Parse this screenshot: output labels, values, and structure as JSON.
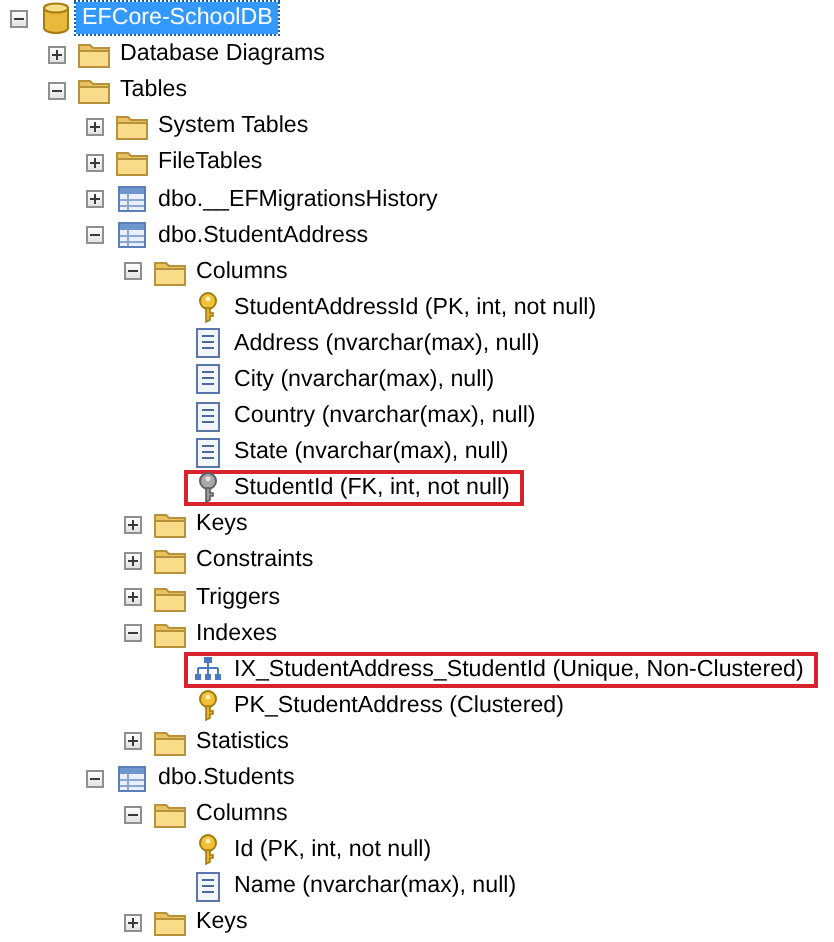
{
  "tree": [
    {
      "label": "EFCore-SchoolDB",
      "kind": "database",
      "expanded": true,
      "selected": true,
      "callout": false,
      "children": [
        {
          "label": "Database Diagrams",
          "kind": "folder",
          "expanded": false,
          "selected": false,
          "callout": false
        },
        {
          "label": "Tables",
          "kind": "folder",
          "expanded": true,
          "selected": false,
          "callout": false,
          "children": [
            {
              "label": "System Tables",
              "kind": "folder",
              "expanded": false,
              "selected": false,
              "callout": false
            },
            {
              "label": "FileTables",
              "kind": "folder",
              "expanded": false,
              "selected": false,
              "callout": false
            },
            {
              "label": "dbo.__EFMigrationsHistory",
              "kind": "table",
              "expanded": false,
              "selected": false,
              "callout": false
            },
            {
              "label": "dbo.StudentAddress",
              "kind": "table",
              "expanded": true,
              "selected": false,
              "callout": false,
              "children": [
                {
                  "label": "Columns",
                  "kind": "folder",
                  "expanded": true,
                  "selected": false,
                  "callout": false,
                  "children": [
                    {
                      "label": "StudentAddressId (PK, int, not null)",
                      "kind": "key",
                      "selected": false,
                      "callout": false
                    },
                    {
                      "label": "Address (nvarchar(max), null)",
                      "kind": "column",
                      "selected": false,
                      "callout": false
                    },
                    {
                      "label": "City (nvarchar(max), null)",
                      "kind": "column",
                      "selected": false,
                      "callout": false
                    },
                    {
                      "label": "Country (nvarchar(max), null)",
                      "kind": "column",
                      "selected": false,
                      "callout": false
                    },
                    {
                      "label": "State (nvarchar(max), null)",
                      "kind": "column",
                      "selected": false,
                      "callout": false
                    },
                    {
                      "label": "StudentId (FK, int, not null)",
                      "kind": "foreign-key",
                      "selected": false,
                      "callout": true
                    }
                  ]
                },
                {
                  "label": "Keys",
                  "kind": "folder",
                  "expanded": false,
                  "selected": false,
                  "callout": false
                },
                {
                  "label": "Constraints",
                  "kind": "folder",
                  "expanded": false,
                  "selected": false,
                  "callout": false
                },
                {
                  "label": "Triggers",
                  "kind": "folder",
                  "expanded": false,
                  "selected": false,
                  "callout": false
                },
                {
                  "label": "Indexes",
                  "kind": "folder",
                  "expanded": true,
                  "selected": false,
                  "callout": false,
                  "children": [
                    {
                      "label": "IX_StudentAddress_StudentId (Unique, Non-Clustered)",
                      "kind": "index",
                      "selected": false,
                      "callout": true
                    },
                    {
                      "label": "PK_StudentAddress (Clustered)",
                      "kind": "key",
                      "selected": false,
                      "callout": false
                    }
                  ]
                },
                {
                  "label": "Statistics",
                  "kind": "folder",
                  "expanded": false,
                  "selected": false,
                  "callout": false
                }
              ]
            },
            {
              "label": "dbo.Students",
              "kind": "table",
              "expanded": true,
              "selected": false,
              "callout": false,
              "children": [
                {
                  "label": "Columns",
                  "kind": "folder",
                  "expanded": true,
                  "selected": false,
                  "callout": false,
                  "children": [
                    {
                      "label": "Id (PK, int, not null)",
                      "kind": "key",
                      "selected": false,
                      "callout": false
                    },
                    {
                      "label": "Name (nvarchar(max), null)",
                      "kind": "column",
                      "selected": false,
                      "callout": false
                    }
                  ]
                },
                {
                  "label": "Keys",
                  "kind": "folder",
                  "expanded": false,
                  "selected": false,
                  "callout": false
                }
              ]
            }
          ]
        }
      ]
    }
  ]
}
